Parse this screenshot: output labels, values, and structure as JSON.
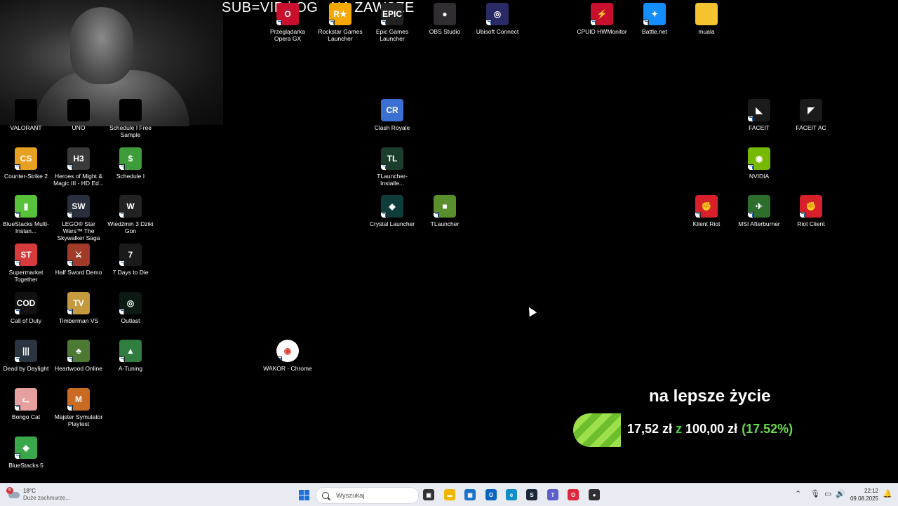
{
  "overlay_text": "SUB=VIP i OG   NA ZAWSZE",
  "desktop_icons": [
    {
      "label": "Przeglądarka Opera GX",
      "glyph": "O",
      "color": "#c8102e",
      "sc": true
    },
    {
      "label": "Rockstar Games Launcher",
      "glyph": "R★",
      "color": "#f5a800",
      "sc": true
    },
    {
      "label": "Epic Games Launcher",
      "glyph": "EPIC",
      "color": "#222",
      "sc": true
    },
    {
      "label": "OBS Studio",
      "glyph": "●",
      "color": "#302e31",
      "sc": false
    },
    {
      "label": "Ubisoft Connect",
      "glyph": "◎",
      "color": "#2a2a66",
      "sc": true
    },
    {
      "label": "CPUID HWMonitor",
      "glyph": "⚡",
      "color": "#c8102e",
      "sc": true
    },
    {
      "label": "Battle.net",
      "glyph": "✦",
      "color": "#148eff",
      "sc": true
    },
    {
      "label": "muala",
      "glyph": "",
      "color": "#f4c430",
      "sc": false
    },
    {
      "label": "VALORANT",
      "glyph": "",
      "color": "#000",
      "sc": false
    },
    {
      "label": "UNO",
      "glyph": "",
      "color": "#000",
      "sc": false
    },
    {
      "label": "Schedule I Free Sample",
      "glyph": "",
      "color": "#000",
      "sc": false
    },
    {
      "label": "Clash Royale",
      "glyph": "CR",
      "color": "#3b6fd1",
      "sc": false
    },
    {
      "label": "FACEIT",
      "glyph": "◣",
      "color": "#1b1b1b",
      "sc": true
    },
    {
      "label": "FACEIT AC",
      "glyph": "◤",
      "color": "#1b1b1b",
      "sc": false
    },
    {
      "label": "Counter-Strike 2",
      "glyph": "CS",
      "color": "#e6a122",
      "sc": true
    },
    {
      "label": "Heroes of Might & Magic III - HD Ed...",
      "glyph": "H3",
      "color": "#3a3a3a",
      "sc": true
    },
    {
      "label": "Schedule I",
      "glyph": "$",
      "color": "#3d9d3a",
      "sc": true
    },
    {
      "label": "TLauncher-Installe...",
      "glyph": "TL",
      "color": "#1b3d2c",
      "sc": true
    },
    {
      "label": "NVIDIA",
      "glyph": "◉",
      "color": "#76b900",
      "sc": true
    },
    {
      "label": "BlueStacks Multi-Instan...",
      "glyph": "▮",
      "color": "#57c23a",
      "sc": true
    },
    {
      "label": "LEGO® Star Wars™ The Skywalker Saga",
      "glyph": "SW",
      "color": "#2a2f3d",
      "sc": true
    },
    {
      "label": "Wiedźmin 3 Dziki Gon",
      "glyph": "W",
      "color": "#222",
      "sc": true
    },
    {
      "label": "Crystal Launcher",
      "glyph": "◆",
      "color": "#0f3d3a",
      "sc": true
    },
    {
      "label": "TLauncher",
      "glyph": "■",
      "color": "#5a8f2e",
      "sc": true
    },
    {
      "label": "Klient Riot",
      "glyph": "✊",
      "color": "#d8202a",
      "sc": true
    },
    {
      "label": "MSI Afterburner",
      "glyph": "✈",
      "color": "#2d6e2d",
      "sc": true
    },
    {
      "label": "Riot Client",
      "glyph": "✊",
      "color": "#d8202a",
      "sc": true
    },
    {
      "label": "Supermarket Together",
      "glyph": "ST",
      "color": "#d63a3a",
      "sc": true
    },
    {
      "label": "Half Sword Demo",
      "glyph": "⚔",
      "color": "#a13a28",
      "sc": true
    },
    {
      "label": "7 Days to Die",
      "glyph": "7",
      "color": "#1a1a1a",
      "sc": true
    },
    {
      "label": "Call of Duty",
      "glyph": "COD",
      "color": "#111",
      "sc": true
    },
    {
      "label": "Timberman VS",
      "glyph": "TV",
      "color": "#c59a3f",
      "sc": true
    },
    {
      "label": "Outlast",
      "glyph": "◎",
      "color": "#0c1a14",
      "sc": true
    },
    {
      "label": "Dead by Daylight",
      "glyph": "|||",
      "color": "#2a3540",
      "sc": true
    },
    {
      "label": "Heartwood Online",
      "glyph": "♣",
      "color": "#4c7a35",
      "sc": true
    },
    {
      "label": "A-Tuning",
      "glyph": "▲",
      "color": "#2f7d3f",
      "sc": true
    },
    {
      "label": "WAKOR - Chrome",
      "glyph": "◉",
      "color": "#ffffff",
      "sc": true
    },
    {
      "label": "Bongo Cat",
      "glyph": "ᓚ",
      "color": "#e6a0a0",
      "sc": true
    },
    {
      "label": "Majster Symulator Playtest",
      "glyph": "M",
      "color": "#c96b22",
      "sc": true
    },
    {
      "label": "BlueStacks 5",
      "glyph": "◆",
      "color": "#3aa84a",
      "sc": true
    }
  ],
  "donation_goal": {
    "title": "na lepsze życie",
    "current": "17,52 zł",
    "separator": "z",
    "target": "100,00 zł",
    "percent_text": "(17.52%)",
    "progress": 0.1752
  },
  "taskbar": {
    "weather_badge": "6",
    "temperature": "18°C",
    "weather_desc": "Duże zachmurze...",
    "search_placeholder": "Wyszukaj",
    "apps": [
      {
        "name": "task-view",
        "glyph": "▣",
        "color": "#333"
      },
      {
        "name": "file-explorer",
        "glyph": "▬",
        "color": "#f2b600"
      },
      {
        "name": "microsoft-store",
        "glyph": "▦",
        "color": "#1a73c8"
      },
      {
        "name": "outlook",
        "glyph": "O",
        "color": "#0a64c2"
      },
      {
        "name": "edge",
        "glyph": "e",
        "color": "#0f8dc8"
      },
      {
        "name": "steam",
        "glyph": "S",
        "color": "#1b2838"
      },
      {
        "name": "teams",
        "glyph": "T",
        "color": "#5b5fc7"
      },
      {
        "name": "opera-gx",
        "glyph": "O",
        "color": "#e0263a"
      },
      {
        "name": "obs-recording",
        "glyph": "●",
        "color": "#302e31"
      }
    ],
    "time": "22:12",
    "date": "09.08.2025"
  }
}
